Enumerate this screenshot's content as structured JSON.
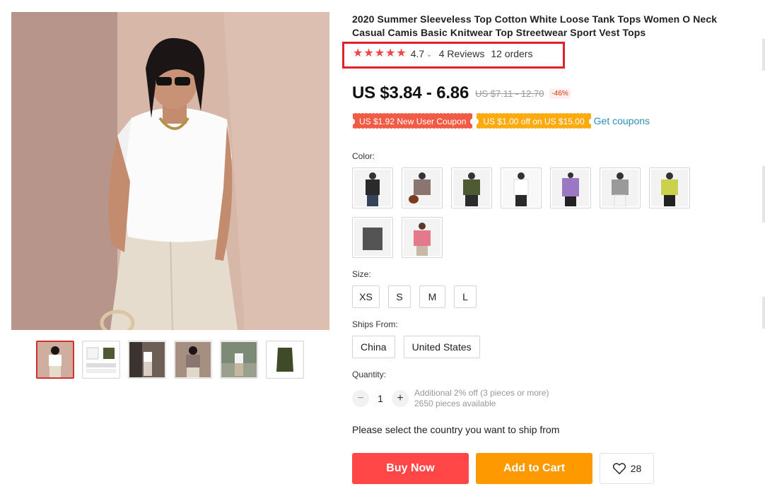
{
  "product": {
    "title": "2020 Summer Sleeveless Top Cotton White Loose Tank Tops Women O Neck Casual Camis Basic Knitwear Top Streetwear Sport Vest Tops"
  },
  "rating": {
    "stars": 5,
    "value": "4.7",
    "reviews": "4 Reviews",
    "orders": "12 orders",
    "star_color": "#f04545",
    "highlight_color": "#e0202a"
  },
  "price": {
    "current": "US $3.84 - 6.86",
    "original": "US $7.11 - 12.70",
    "discount": "-46%"
  },
  "coupons": {
    "new_user": "US $1.92 New User Coupon",
    "off": "US $1.00 off on US $15.00",
    "get": "Get coupons"
  },
  "color": {
    "label": "Color:",
    "options": [
      {
        "name": "black",
        "hex": "#2a2a2a"
      },
      {
        "name": "mocha",
        "hex": "#8a7570"
      },
      {
        "name": "army green",
        "hex": "#4d5a32"
      },
      {
        "name": "white",
        "hex": "#f4f4f4"
      },
      {
        "name": "purple",
        "hex": "#9c78c4"
      },
      {
        "name": "gray",
        "hex": "#9a9a9a"
      },
      {
        "name": "lime",
        "hex": "#c9d24a"
      },
      {
        "name": "dark gray",
        "hex": "#545454"
      },
      {
        "name": "pink",
        "hex": "#e5798c"
      }
    ]
  },
  "size": {
    "label": "Size:",
    "options": [
      "XS",
      "S",
      "M",
      "L"
    ]
  },
  "ships_from": {
    "label": "Ships From:",
    "options": [
      "China",
      "United States"
    ]
  },
  "quantity": {
    "label": "Quantity:",
    "value": "1",
    "minus": "−",
    "plus": "+",
    "discount_note": "Additional 2% off (3 pieces or more)",
    "available": "2650 pieces available"
  },
  "ship_message": "Please select the country you want to ship from",
  "actions": {
    "buy_now": "Buy Now",
    "add_to_cart": "Add to Cart",
    "wishlist_count": "28"
  },
  "gallery": {
    "thumbnails": [
      "model front white",
      "product flat lay",
      "street outfit",
      "model mocha",
      "model outdoor",
      "green flat lay"
    ]
  },
  "colors": {
    "buy_now": "#ff4747",
    "add_to_cart": "#ff9900",
    "coupon_red": "#f15a45",
    "coupon_orange": "#ffab0f",
    "link": "#2e8fb8"
  }
}
